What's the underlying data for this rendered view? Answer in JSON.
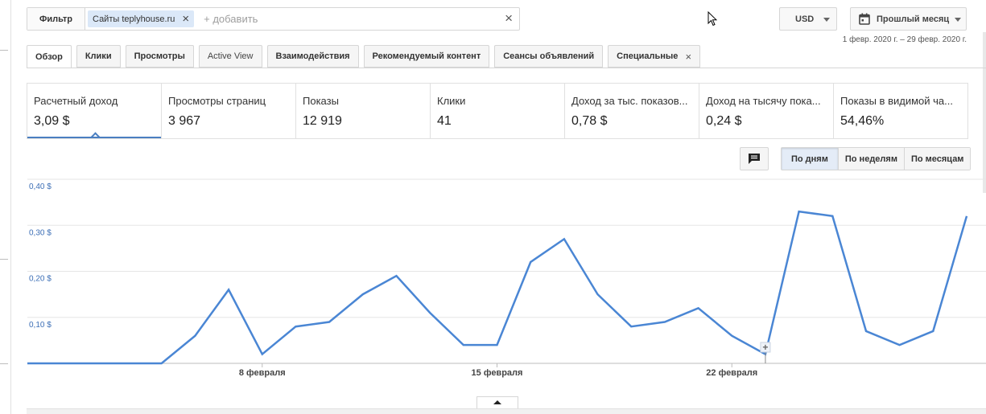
{
  "filter": {
    "button_label": "Фильтр",
    "chip_label": "Сайты teplyhouse.ru",
    "add_placeholder": "+ добавить"
  },
  "currency": {
    "selected": "USD"
  },
  "date_range": {
    "label": "Прошлый месяц",
    "range_text": "1 февр. 2020 г. – 29 февр. 2020 г."
  },
  "tabs": [
    {
      "label": "Обзор",
      "active": true
    },
    {
      "label": "Клики"
    },
    {
      "label": "Просмотры"
    },
    {
      "label": "Active View"
    },
    {
      "label": "Взаимодействия"
    },
    {
      "label": "Рекомендуемый контент"
    },
    {
      "label": "Сеансы объявлений"
    },
    {
      "label": "Специальные",
      "closable": true
    }
  ],
  "metrics": [
    {
      "label": "Расчетный доход",
      "value": "3,09 $",
      "active": true
    },
    {
      "label": "Просмотры страниц",
      "value": "3 967"
    },
    {
      "label": "Показы",
      "value": "12 919"
    },
    {
      "label": "Клики",
      "value": "41"
    },
    {
      "label": "Доход за тыс. показов...",
      "value": "0,78 $"
    },
    {
      "label": "Доход на тысячу пока...",
      "value": "0,24 $"
    },
    {
      "label": "Показы в видимой ча...",
      "value": "54,46%"
    }
  ],
  "granularity": [
    {
      "label": "По дням",
      "active": true
    },
    {
      "label": "По неделям"
    },
    {
      "label": "По месяцам"
    }
  ],
  "colors": {
    "line": "#4a86d4",
    "axis_label": "#3d6fb6",
    "accent": "#4a7fc1"
  },
  "chart_data": {
    "type": "line",
    "x": [
      "2020-02-01",
      "2020-02-02",
      "2020-02-03",
      "2020-02-04",
      "2020-02-05",
      "2020-02-06",
      "2020-02-07",
      "2020-02-08",
      "2020-02-09",
      "2020-02-10",
      "2020-02-11",
      "2020-02-12",
      "2020-02-13",
      "2020-02-14",
      "2020-02-15",
      "2020-02-16",
      "2020-02-17",
      "2020-02-18",
      "2020-02-19",
      "2020-02-20",
      "2020-02-21",
      "2020-02-22",
      "2020-02-23",
      "2020-02-24",
      "2020-02-25",
      "2020-02-26",
      "2020-02-27",
      "2020-02-28",
      "2020-02-29"
    ],
    "series": [
      {
        "values": [
          0,
          0,
          0,
          0,
          0,
          0.06,
          0.16,
          0.02,
          0.08,
          0.09,
          0.15,
          0.19,
          0.11,
          0.04,
          0.04,
          0.22,
          0.27,
          0.15,
          0.08,
          0.09,
          0.12,
          0.06,
          0.02,
          0.33,
          0.32,
          0.07,
          0.04,
          0.07,
          0.32
        ]
      }
    ],
    "ylim": [
      0,
      0.4
    ],
    "y_ticks": [
      {
        "value": 0.1,
        "label": "0,10 $"
      },
      {
        "value": 0.2,
        "label": "0,20 $"
      },
      {
        "value": 0.3,
        "label": "0,30 $"
      },
      {
        "value": 0.4,
        "label": "0,40 $"
      }
    ],
    "x_ticks": [
      {
        "index": 7,
        "label": "8 февраля"
      },
      {
        "index": 14,
        "label": "15 февраля"
      },
      {
        "index": 21,
        "label": "22 февраля"
      }
    ],
    "annotation_marker_index": 22,
    "grid": true
  }
}
